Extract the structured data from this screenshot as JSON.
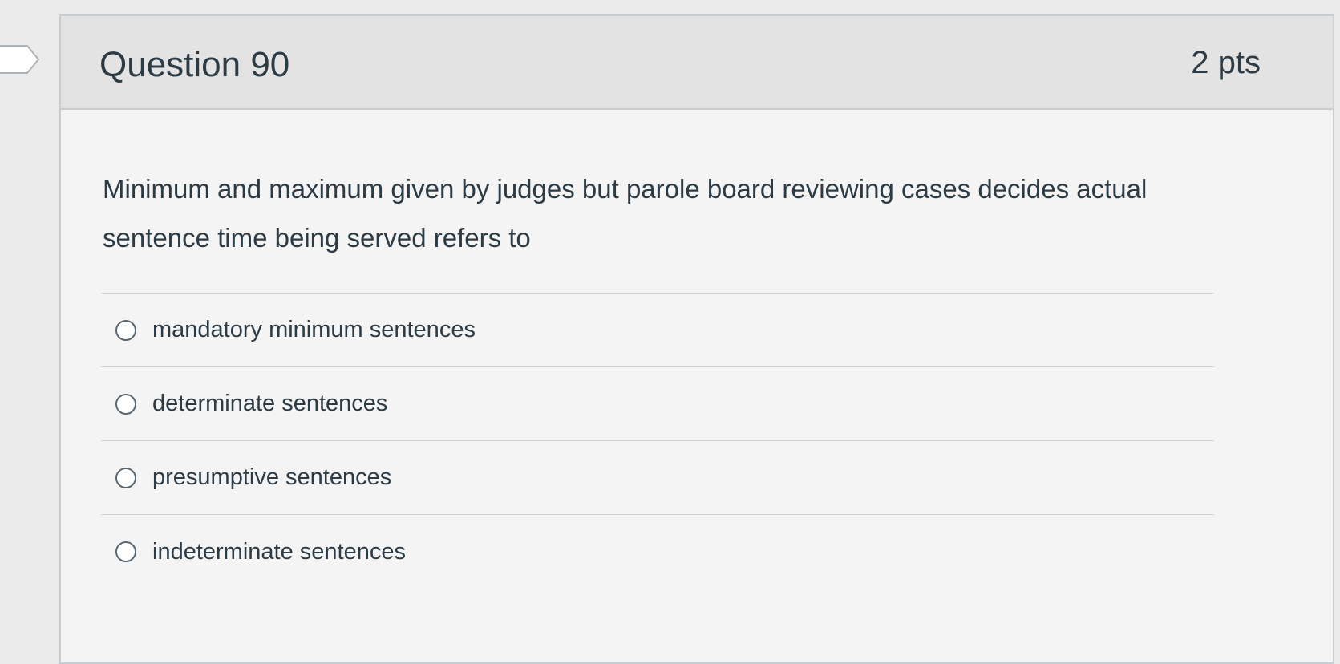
{
  "question": {
    "title": "Question 90",
    "points": "2 pts",
    "text": "Minimum and maximum given by judges but parole board reviewing cases decides actual sentence time being served refers to",
    "answers": [
      {
        "label": "mandatory minimum sentences"
      },
      {
        "label": "determinate sentences"
      },
      {
        "label": "presumptive sentences"
      },
      {
        "label": "indeterminate sentences"
      }
    ]
  },
  "icons": {
    "flag": "flag-question-icon",
    "radio": "radio-unselected-icon"
  },
  "colors": {
    "text": "#2d3b45",
    "header_background": "#e3e3e3",
    "card_background": "#f4f4f4",
    "border": "#c7cdd1"
  }
}
